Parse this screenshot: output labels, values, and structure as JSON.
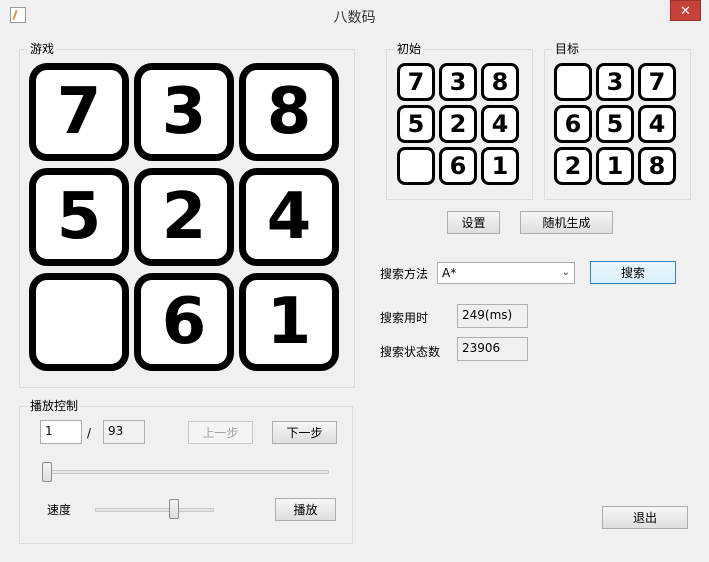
{
  "window": {
    "title": "八数码",
    "close_label": "✕"
  },
  "game": {
    "label": "游戏",
    "tiles": [
      "7",
      "3",
      "8",
      "5",
      "2",
      "4",
      "",
      "6",
      "1"
    ]
  },
  "initial": {
    "label": "初始",
    "tiles": [
      "7",
      "3",
      "8",
      "5",
      "2",
      "4",
      "",
      "6",
      "1"
    ]
  },
  "target": {
    "label": "目标",
    "tiles": [
      "",
      "3",
      "7",
      "6",
      "5",
      "4",
      "2",
      "1",
      "8"
    ]
  },
  "buttons": {
    "set": "设置",
    "random": "随机生成",
    "search": "搜索",
    "prev": "上一步",
    "next": "下一步",
    "play": "播放",
    "exit": "退出"
  },
  "search": {
    "method_label": "搜索方法",
    "method_value": "A*",
    "time_label": "搜索用时",
    "time_value": "249(ms)",
    "states_label": "搜索状态数",
    "states_value": "23906"
  },
  "playback": {
    "label": "播放控制",
    "step_current": "1",
    "separator": "/",
    "step_total": "93",
    "speed_label": "速度",
    "progress_fraction": 0.0,
    "speed_fraction": 0.68
  }
}
